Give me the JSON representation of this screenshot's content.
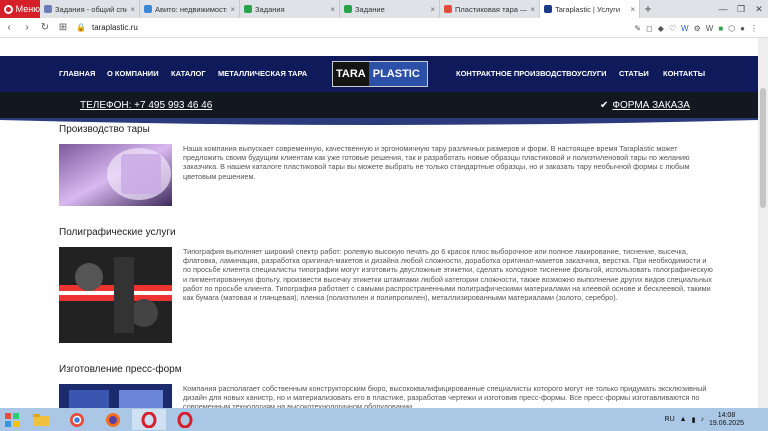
{
  "browser": {
    "menu_label": "Меню",
    "tabs": [
      {
        "label": "Задания - общий спис",
        "color": "#6c7cb8"
      },
      {
        "label": "Авито: недвижимость",
        "color": "#3a88d4"
      },
      {
        "label": "Задания",
        "color": "#2aa44a"
      },
      {
        "label": "Задание",
        "color": "#2aa44a"
      },
      {
        "label": "Пластиковая тара — ",
        "color": "#e14b3b"
      },
      {
        "label": "Taraplastic | Услуги",
        "color": "#1a3a8a"
      }
    ],
    "url": "taraplastic.ru"
  },
  "site": {
    "nav_left": [
      "ГЛАВНАЯ",
      "О КОМПАНИИ",
      "КАТАЛОГ",
      "МЕТАЛЛИЧЕСКАЯ ТАРА"
    ],
    "nav_right": [
      "КОНТРАКТНОЕ ПРОИЗВОДСТВО",
      "УСЛУГИ",
      "СТАТЬИ",
      "КОНТАКТЫ"
    ],
    "logo_left": "TARA",
    "logo_right": "PLASTIC",
    "phone": "ТЕЛЕФОН: +7 495 993 46 46",
    "order": "ФОРМА ЗАКАЗА",
    "sections": [
      {
        "title": "Производство тары",
        "text": "Наша компания выпускает современную, качественную и эргономичную тару различных  размеров и форм. В настоящее время Taraplastic может предложить своим будущим клиентам как уже готовые решения, так и разработать новые образцы пластиковой и полиэтиленовой тары по желанию заказчика. В нашем каталоге пластиковой тары вы можете выбрать не только стандартные образцы, но и заказать тару необычной формы с любым цветовым решением."
      },
      {
        "title": "Полиграфические услуги",
        "text": "Типография выполняет широкий спектр работ: ролевую высокую печать до 6 красок плюс выборочное или полное лакирование, тиснение, высечка, флатовка, ламинация, разработка оригинал-макетов и дизайна любой сложности, доработка оригинал-макетов заказчика, верстка. При необходимости и по просьбе клиента специалисты типографии могут изготовить двусложные этикетки, сделать холодное тиснение фольгой, использовать голографическую и пигментированную фольгу, произвести высечку этикетки штампами любой категории сложности, также возможно выполнение других видов специальных работ по просьбе клиента. Типография работает с самыми распространенными полиграфическими материалами на клеевой основе и бесклеевой, такими как бумага (матовая и глянцевая), пленка (полиэтилен и полипропилен),  металлизированными материалами (золото, серебро)."
      },
      {
        "title": "Изготовление пресс-форм",
        "text": "Компания располагает собственным конструкторским бюро, высококвалифицированные специалисты которого могут не только придумать эксклюзивный дизайн для новых канистр, но и материализовать его в пластике, разработав чертежи и изготовив пресс-формы. Все пресс-формы изготавливаются по современным технологиям на высокотехнологичном оборудовании."
      }
    ]
  },
  "taskbar": {
    "lang": "RU",
    "time": "14:08",
    "date": "19.06.2025"
  }
}
